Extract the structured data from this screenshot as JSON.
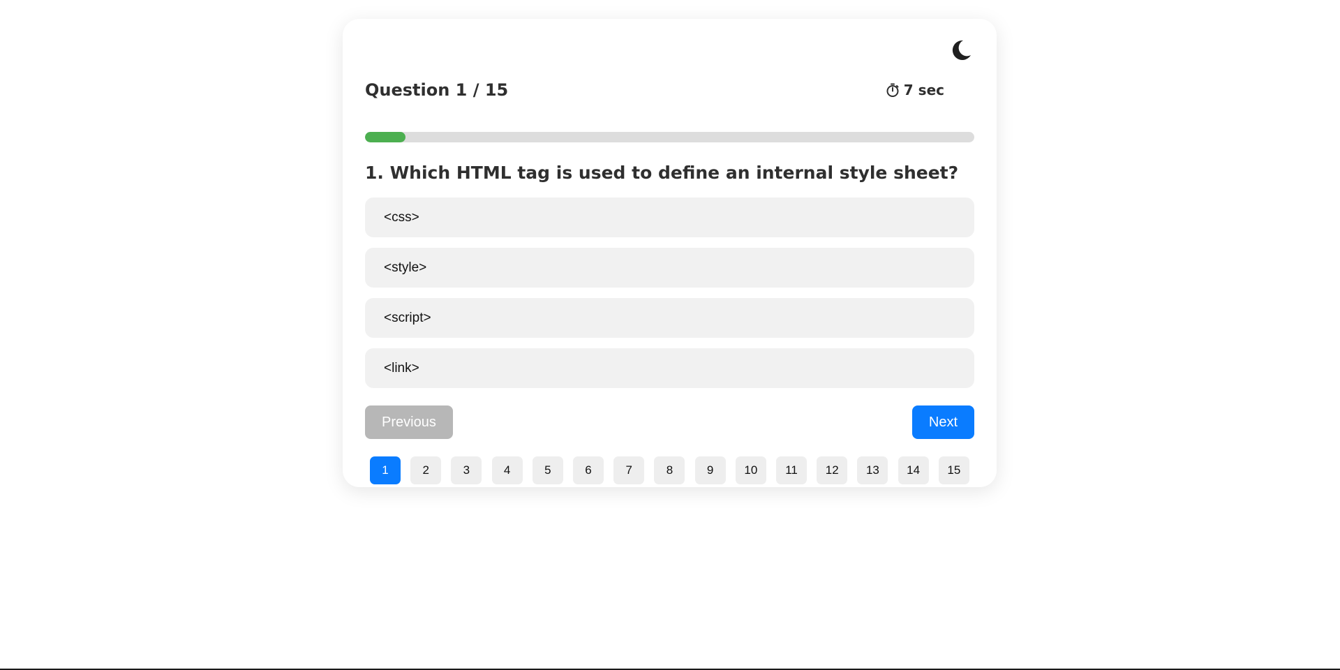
{
  "quiz": {
    "counter": "Question 1 / 15",
    "timer": "7 sec",
    "timer_icon": "stopwatch-icon",
    "theme_icon": "moon-icon",
    "progress": 0.0667,
    "question": "1. Which HTML tag is used to define an internal style sheet?",
    "options": [
      "<css>",
      "<style>",
      "<script>",
      "<link>"
    ],
    "nav": {
      "previous_label": "Previous",
      "next_label": "Next"
    },
    "pages": [
      "1",
      "2",
      "3",
      "4",
      "5",
      "6",
      "7",
      "8",
      "9",
      "10",
      "11",
      "12",
      "13",
      "14",
      "15"
    ],
    "current_page": "1"
  },
  "colors": {
    "accent": "#0a7cff",
    "progress": "#4caf50",
    "disabled": "#b7b7b7",
    "option_bg": "#f1f1f1"
  }
}
